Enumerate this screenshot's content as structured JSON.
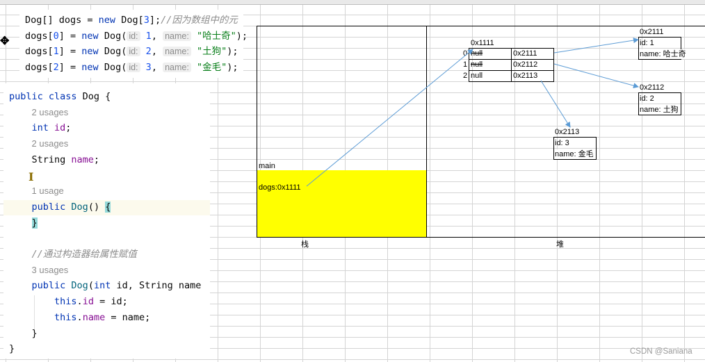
{
  "snippet": [
    [
      [
        "Dog[] dogs = ",
        "pl"
      ],
      [
        "new",
        "kw"
      ],
      [
        " Dog[",
        "pl"
      ],
      [
        "3",
        "num"
      ],
      [
        "];",
        "pl"
      ],
      [
        "//因为数组中的元",
        "cm"
      ]
    ],
    [
      [
        "dogs[",
        "pl"
      ],
      [
        "0",
        "num"
      ],
      [
        "] = ",
        "pl"
      ],
      [
        "new",
        "kw"
      ],
      [
        " Dog(",
        "pl"
      ],
      [
        "id:",
        "hint"
      ],
      [
        " ",
        "pl"
      ],
      [
        "1",
        "num"
      ],
      [
        ", ",
        "pl"
      ],
      [
        "name:",
        "hint"
      ],
      [
        " ",
        "pl"
      ],
      [
        "\"哈士奇\"",
        "str"
      ],
      [
        ");",
        "pl"
      ]
    ],
    [
      [
        "dogs[",
        "pl"
      ],
      [
        "1",
        "num"
      ],
      [
        "] = ",
        "pl"
      ],
      [
        "new",
        "kw"
      ],
      [
        " Dog(",
        "pl"
      ],
      [
        "id:",
        "hint"
      ],
      [
        " ",
        "pl"
      ],
      [
        "2",
        "num"
      ],
      [
        ", ",
        "pl"
      ],
      [
        "name:",
        "hint"
      ],
      [
        " ",
        "pl"
      ],
      [
        "\"土狗\"",
        "str"
      ],
      [
        ");",
        "pl"
      ]
    ],
    [
      [
        "dogs[",
        "pl"
      ],
      [
        "2",
        "num"
      ],
      [
        "] = ",
        "pl"
      ],
      [
        "new",
        "kw"
      ],
      [
        " Dog(",
        "pl"
      ],
      [
        "id:",
        "hint"
      ],
      [
        " ",
        "pl"
      ],
      [
        "3",
        "num"
      ],
      [
        ", ",
        "pl"
      ],
      [
        "name:",
        "hint"
      ],
      [
        " ",
        "pl"
      ],
      [
        "\"金毛\"",
        "str"
      ],
      [
        ");",
        "pl"
      ]
    ]
  ],
  "class_code": [
    [
      [
        "public class ",
        "kw"
      ],
      [
        "Dog {",
        "pl"
      ]
    ],
    [
      [
        "    ",
        "pl"
      ],
      [
        "2 usages",
        "usage"
      ]
    ],
    [
      [
        "    ",
        "pl"
      ],
      [
        "int ",
        "kw"
      ],
      [
        "id",
        "fld"
      ],
      [
        ";",
        "pl"
      ]
    ],
    [
      [
        "    ",
        "pl"
      ],
      [
        "2 usages",
        "usage"
      ]
    ],
    [
      [
        "    String ",
        "pl"
      ],
      [
        "name",
        "fld"
      ],
      [
        ";",
        "pl"
      ]
    ],
    [
      [
        "",
        "pl"
      ]
    ],
    [
      [
        "    ",
        "pl"
      ],
      [
        "1 usage",
        "usage"
      ]
    ],
    [
      [
        "    ",
        "pl"
      ],
      [
        "public ",
        "kw"
      ],
      [
        "Dog",
        "fn"
      ],
      [
        "() ",
        "pl"
      ],
      [
        "{",
        "brace"
      ]
    ],
    [
      [
        "    ",
        "pl"
      ],
      [
        "}",
        "brace"
      ]
    ],
    [
      [
        "",
        "pl"
      ]
    ],
    [
      [
        "    ",
        "pl"
      ],
      [
        "//通过构造器给属性赋值",
        "cm"
      ]
    ],
    [
      [
        "    ",
        "pl"
      ],
      [
        "3 usages",
        "usage"
      ]
    ],
    [
      [
        "    ",
        "pl"
      ],
      [
        "public ",
        "kw"
      ],
      [
        "Dog",
        "fn"
      ],
      [
        "(",
        "pl"
      ],
      [
        "int ",
        "kw"
      ],
      [
        "id, String name",
        "pl"
      ]
    ],
    [
      [
        "        ",
        "pl"
      ],
      [
        "this",
        "kw"
      ],
      [
        ".",
        "pl"
      ],
      [
        "id",
        "fld"
      ],
      [
        " = id;",
        "pl"
      ]
    ],
    [
      [
        "        ",
        "pl"
      ],
      [
        "this",
        "kw"
      ],
      [
        ".",
        "pl"
      ],
      [
        "name",
        "fld"
      ],
      [
        " = name;",
        "pl"
      ]
    ],
    [
      [
        "    }",
        "pl"
      ]
    ],
    [
      [
        "}",
        "pl"
      ]
    ]
  ],
  "diagram": {
    "stack": {
      "frame_label": "main",
      "var": "dogs:0x1111",
      "caption": "栈",
      "fill": "#ffff00"
    },
    "heap": {
      "caption": "堆",
      "array": {
        "address": "0x1111",
        "rows": [
          {
            "index": "0",
            "old": "null",
            "value": "0x2111",
            "struck": true
          },
          {
            "index": "1",
            "old": "null",
            "value": "0x2112",
            "struck": true
          },
          {
            "index": "2",
            "old": "null",
            "value": "0x2113",
            "struck": false
          }
        ]
      },
      "objects": [
        {
          "address": "0x2111",
          "id": "id:  1",
          "name": "name: 哈士奇"
        },
        {
          "address": "0x2112",
          "id": "id:  2",
          "name": "name: 土狗"
        },
        {
          "address": "0x2113",
          "id": "id:  3",
          "name": "name: 金毛"
        }
      ]
    },
    "arrow_color": "#5b9bd5"
  },
  "watermark": "CSDN @Saniana"
}
